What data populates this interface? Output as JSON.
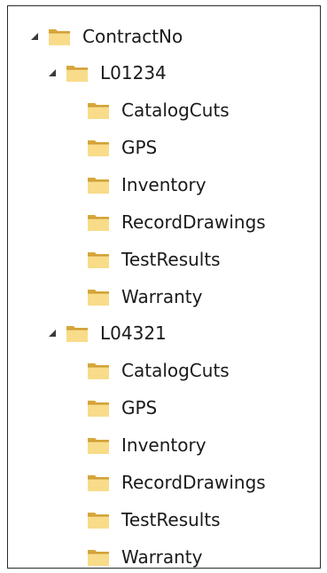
{
  "tree": {
    "root": {
      "label": "ContractNo",
      "children": [
        {
          "label": "L01234",
          "children": [
            "CatalogCuts",
            "GPS",
            "Inventory",
            "RecordDrawings",
            "TestResults",
            "Warranty"
          ]
        },
        {
          "label": "L04321",
          "children": [
            "CatalogCuts",
            "GPS",
            "Inventory",
            "RecordDrawings",
            "TestResults",
            "Warranty"
          ]
        }
      ]
    }
  },
  "icons": {
    "expand": "expanded-caret-icon",
    "folder": "folder-icon"
  },
  "colors": {
    "folder_light": "#f8dc8a",
    "folder_dark": "#d7a83a",
    "caret": "#3b3b3b"
  }
}
